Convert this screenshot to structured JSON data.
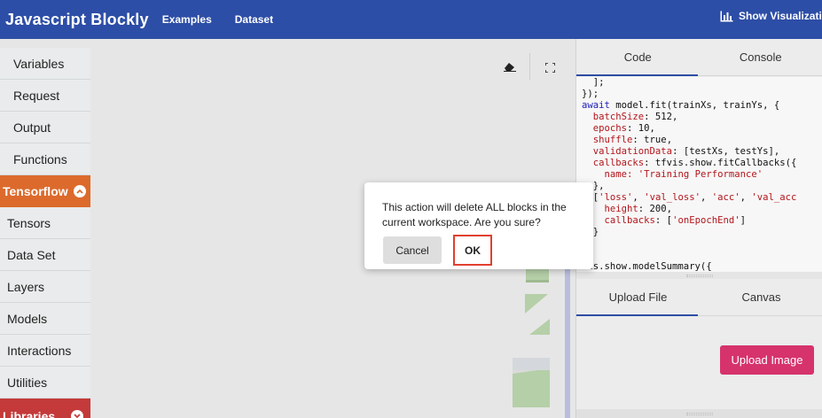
{
  "header": {
    "brand": "Javascript Blockly",
    "nav": [
      "Examples",
      "Dataset"
    ],
    "show_visualization": "Show Visualizatio"
  },
  "sidebar": {
    "items_top": [
      "Variables",
      "Request",
      "Output",
      "Functions"
    ],
    "category_tensorflow": "Tensorflow",
    "items_tf": [
      "Tensors",
      "Data Set",
      "Layers",
      "Models",
      "Interactions",
      "Utilities"
    ],
    "category_libraries": "Libraries"
  },
  "code_panel": {
    "tabs": [
      "Code",
      "Console"
    ],
    "active_tab": "Code",
    "lines": [
      "  ];",
      "});",
      "await model.fit(trainXs, trainYs, {",
      "  batchSize: 512,",
      "  epochs: 10,",
      "  shuffle: true,",
      "  validationData: [testXs, testYs],",
      "  callbacks: tfvis.show.fitCallbacks({",
      "    name: 'Training Performance'",
      "  },",
      "  ['loss', 'val_loss', 'acc', 'val_acc",
      "    height: 200,",
      "    callbacks: ['onEpochEnd']",
      "  }",
      ")",
      ";",
      "vis.show.modelSummary({"
    ]
  },
  "bottom_panel": {
    "tabs": [
      "Upload File",
      "Canvas"
    ],
    "active_tab": "Upload File",
    "upload_button": "Upload Image"
  },
  "dialog": {
    "message": "This action will delete ALL blocks in the current workspace. Are you sure?",
    "cancel": "Cancel",
    "ok": "OK"
  },
  "colors": {
    "header": "#2d4ea6",
    "tensorflow_category": "#dc6a2c",
    "libraries_category": "#c43a3a",
    "upload_button": "#d6336c",
    "ok_highlight": "#e0402e"
  }
}
